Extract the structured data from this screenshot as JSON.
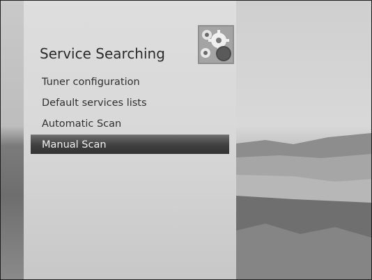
{
  "menu": {
    "title": "Service Searching",
    "header_icon": "settings-gears-icon",
    "selected_index": 3,
    "items": [
      {
        "label": "Tuner configuration"
      },
      {
        "label": "Default services lists"
      },
      {
        "label": "Automatic Scan"
      },
      {
        "label": "Manual Scan"
      }
    ]
  },
  "colors": {
    "selection_bar": "#3c3c3c",
    "panel_background": "#dcdcdc",
    "text": "#303030"
  }
}
